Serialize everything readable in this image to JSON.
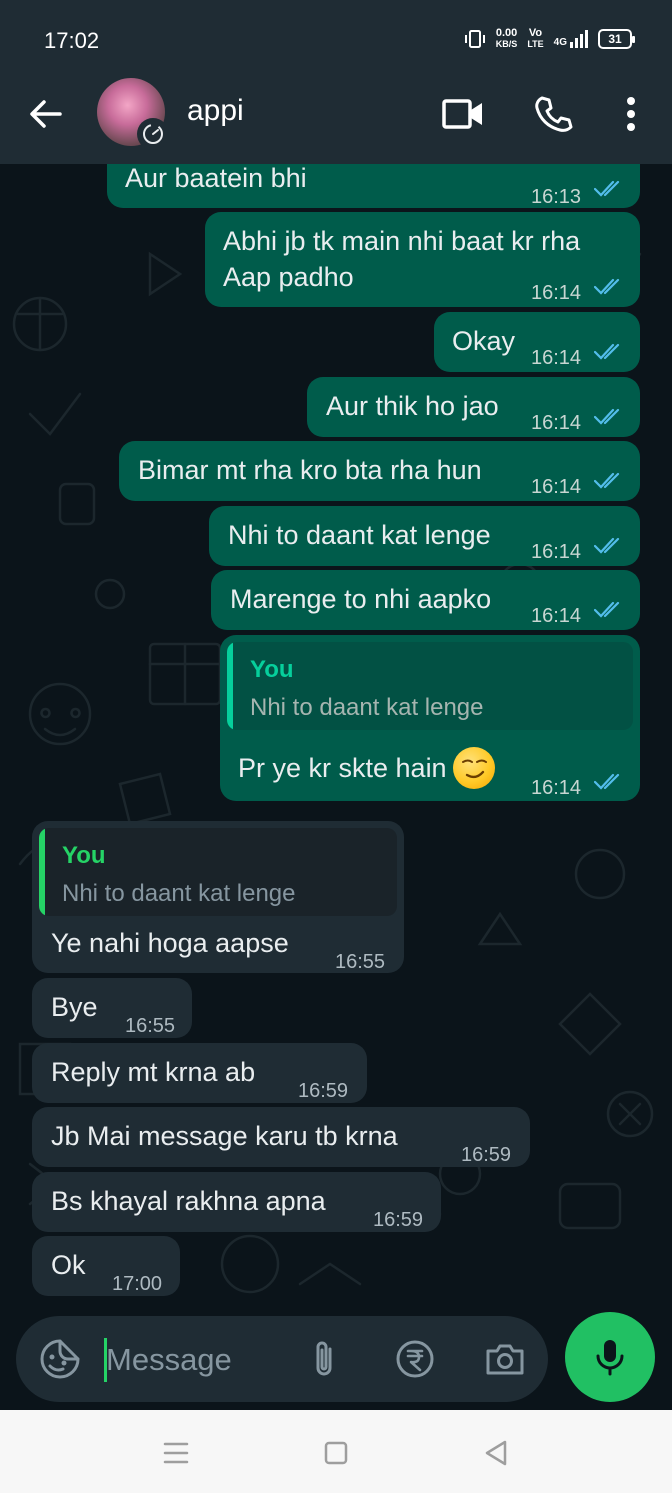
{
  "status_bar": {
    "time": "17:02",
    "net_speed_value": "0.00",
    "net_speed_unit": "KB/S",
    "volte": "Vo",
    "volte_sub": "LTE",
    "network": "4G",
    "battery": "31"
  },
  "header": {
    "contact_name": "appi"
  },
  "messages": [
    {
      "dir": "out",
      "text": "Aur baatein bhi",
      "time": "16:13"
    },
    {
      "dir": "out",
      "text": "Abhi jb tk main nhi baat kr rha\nAap padho",
      "time": "16:14"
    },
    {
      "dir": "out",
      "text": "Okay",
      "time": "16:14"
    },
    {
      "dir": "out",
      "text": "Aur thik ho jao",
      "time": "16:14"
    },
    {
      "dir": "out",
      "text": "Bimar mt rha kro bta rha hun",
      "time": "16:14"
    },
    {
      "dir": "out",
      "text": "Nhi to daant kat lenge",
      "time": "16:14"
    },
    {
      "dir": "out",
      "text": "Marenge to nhi aapko",
      "time": "16:14"
    },
    {
      "dir": "out",
      "text": "Pr ye kr skte hain",
      "time": "16:14",
      "quote_author": "You",
      "quote_text": "Nhi to daant kat lenge",
      "emoji": "smirking-face"
    },
    {
      "dir": "in",
      "text": "Ye nahi hoga aapse",
      "time": "16:55",
      "quote_author": "You",
      "quote_text": "Nhi to daant kat lenge"
    },
    {
      "dir": "in",
      "text": "Bye",
      "time": "16:55"
    },
    {
      "dir": "in",
      "text": "Reply mt krna ab",
      "time": "16:59"
    },
    {
      "dir": "in",
      "text": "Jb Mai message karu tb krna",
      "time": "16:59"
    },
    {
      "dir": "in",
      "text": "Bs khayal rakhna apna",
      "time": "16:59"
    },
    {
      "dir": "in",
      "text": "Ok",
      "time": "17:00"
    }
  ],
  "composer": {
    "placeholder": "Message"
  },
  "colors": {
    "background": "#0b141a",
    "header": "#1f2c34",
    "outgoing_bubble": "#005c4b",
    "incoming_bubble": "#1f2c34",
    "accent": "#25d366",
    "read_tick": "#53bdeb"
  },
  "icons": {
    "back": "arrow-left-icon",
    "video": "video-call-icon",
    "call": "phone-icon",
    "menu": "more-vert-icon",
    "sticker": "sticker-icon",
    "attach": "paperclip-icon",
    "payment": "rupee-icon",
    "camera": "camera-icon",
    "mic": "mic-icon"
  }
}
